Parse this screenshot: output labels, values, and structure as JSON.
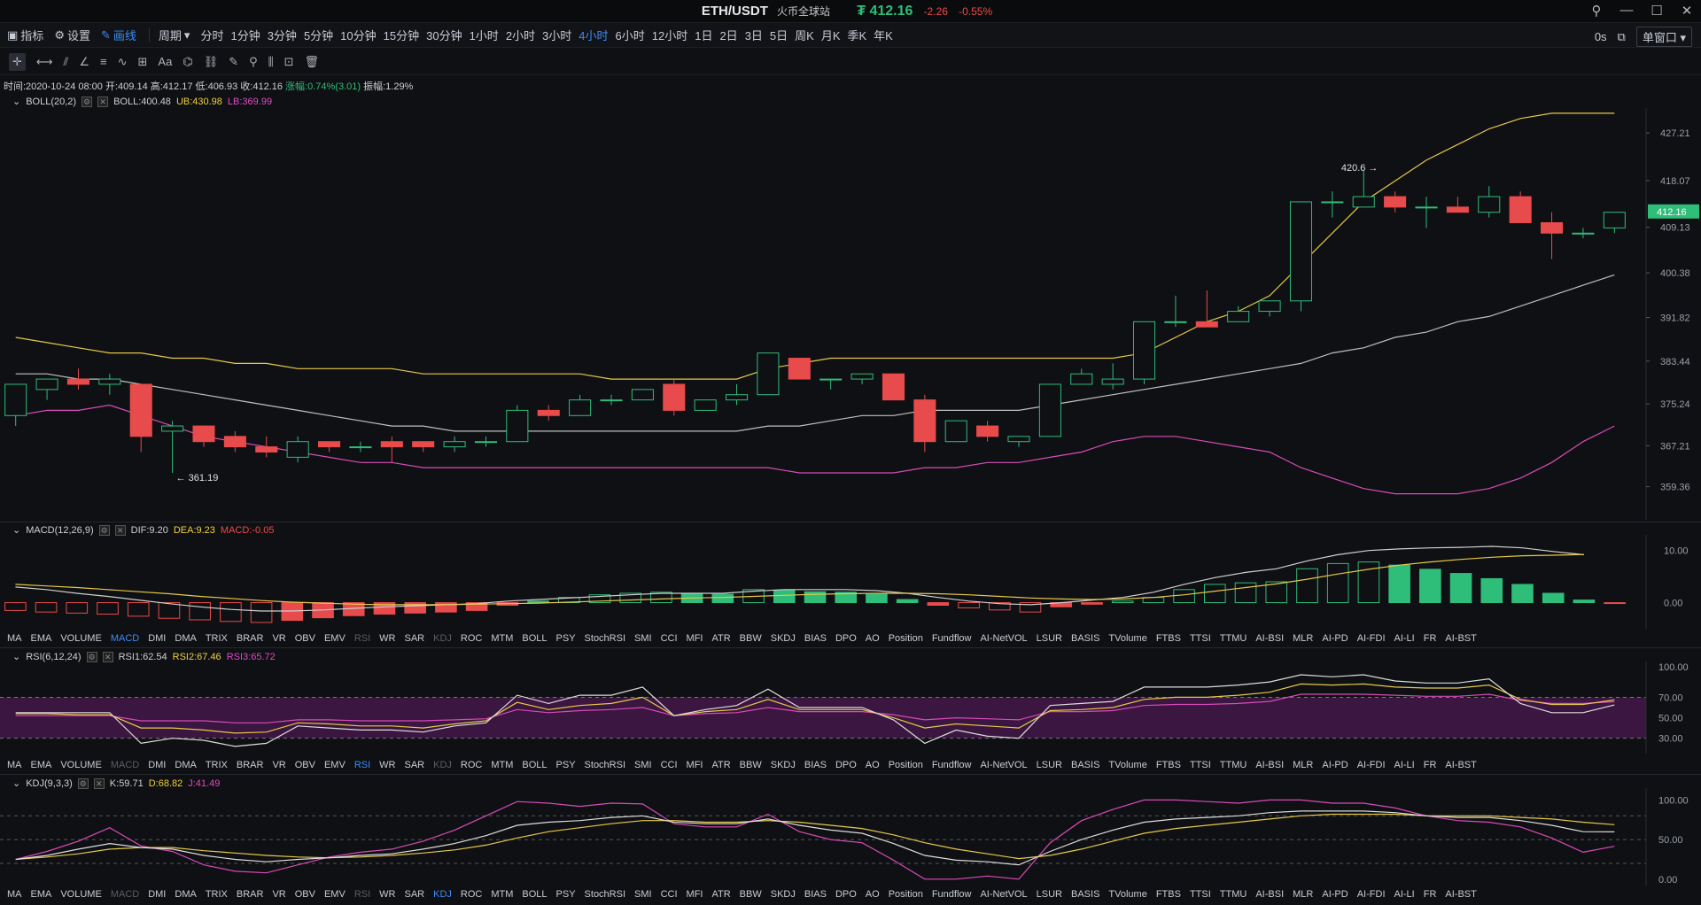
{
  "title": {
    "pair": "ETH/USDT",
    "exchange": "火币全球站",
    "price": "₮ 412.16",
    "change": "-2.26",
    "pct": "-0.55%"
  },
  "toolbar": {
    "indicators": "指标",
    "settings": "设置",
    "draw": "画线",
    "period_label": "周期",
    "periods": [
      "分时",
      "1分钟",
      "3分钟",
      "5分钟",
      "10分钟",
      "15分钟",
      "30分钟",
      "1小时",
      "2小时",
      "3小时",
      "4小时",
      "6小时",
      "12小时",
      "1日",
      "2日",
      "3日",
      "5日",
      "周K",
      "月K",
      "季K",
      "年K"
    ],
    "active_period": "4小时",
    "timer": "0s",
    "window": "单窗口"
  },
  "drawtools": [
    "✛",
    "⟷",
    "⫽",
    "∠",
    "≡",
    "∿",
    "⊞",
    "Aa",
    "⌬",
    "⛓",
    "✎",
    "⚲",
    "⫼",
    "⊡",
    "🗑"
  ],
  "info": {
    "time": "时间:2020-10-24 08:00",
    "open": "开:409.14",
    "high": "高:412.17",
    "low": "低:406.93",
    "close": "收:412.16",
    "chg": "涨幅:0.74%(3.01)",
    "amp": "振幅:1.29%"
  },
  "boll": {
    "name": "BOLL(20,2)",
    "mid": "BOLL:400.48",
    "ub": "UB:430.98",
    "lb": "LB:369.99"
  },
  "macd": {
    "name": "MACD(12,26,9)",
    "dif": "DIF:9.20",
    "dea": "DEA:9.23",
    "macd": "MACD:-0.05"
  },
  "rsi": {
    "name": "RSI(6,12,24)",
    "r1": "RSI1:62.54",
    "r2": "RSI2:67.46",
    "r3": "RSI3:65.72"
  },
  "kdj": {
    "name": "KDJ(9,3,3)",
    "k": "K:59.71",
    "d": "D:68.82",
    "j": "J:41.49"
  },
  "tabs": [
    "MA",
    "EMA",
    "VOLUME",
    "MACD",
    "DMI",
    "DMA",
    "TRIX",
    "BRAR",
    "VR",
    "OBV",
    "EMV",
    "RSI",
    "WR",
    "SAR",
    "KDJ",
    "ROC",
    "MTM",
    "BOLL",
    "PSY",
    "StochRSI",
    "SMI",
    "CCI",
    "MFI",
    "ATR",
    "BBW",
    "SKDJ",
    "BIAS",
    "DPO",
    "AO",
    "Position",
    "Fundflow",
    "AI-NetVOL",
    "LSUR",
    "BASIS",
    "TVolume",
    "FTBS",
    "TTSI",
    "TTMU",
    "AI-BSI",
    "MLR",
    "AI-PD",
    "AI-FDI",
    "AI-LI",
    "FR",
    "AI-BST"
  ],
  "chart_data": [
    {
      "type": "candlestick",
      "title": "ETH/USDT 4小时",
      "y_ticks": [
        427.21,
        418.07,
        409.13,
        400.38,
        391.82,
        383.44,
        375.24,
        367.21,
        359.36
      ],
      "current_price": "412.16",
      "annotations": [
        "420.6 →",
        "← 361.19"
      ],
      "candles": [
        [
          373,
          379,
          371,
          379
        ],
        [
          378,
          380,
          376,
          380
        ],
        [
          380,
          382,
          378,
          379
        ],
        [
          379,
          381,
          377,
          380
        ],
        [
          379,
          379,
          366,
          369
        ],
        [
          370,
          372,
          362,
          371
        ],
        [
          371,
          371,
          367,
          368
        ],
        [
          369,
          370,
          366,
          367
        ],
        [
          367,
          369,
          365,
          366
        ],
        [
          365,
          369,
          364,
          368
        ],
        [
          368,
          368,
          366,
          367
        ],
        [
          367,
          368,
          366,
          367
        ],
        [
          368,
          369,
          364,
          367
        ],
        [
          368,
          368,
          366,
          367
        ],
        [
          367,
          369,
          366,
          368
        ],
        [
          368,
          369,
          367,
          368
        ],
        [
          368,
          375,
          368,
          374
        ],
        [
          374,
          375,
          372,
          373
        ],
        [
          373,
          377,
          373,
          376
        ],
        [
          376,
          377,
          375,
          376
        ],
        [
          376,
          378,
          376,
          378
        ],
        [
          379,
          380,
          373,
          374
        ],
        [
          374,
          376,
          374,
          376
        ],
        [
          376,
          379,
          375,
          377
        ],
        [
          377,
          385,
          377,
          385
        ],
        [
          384,
          384,
          380,
          380
        ],
        [
          380,
          380,
          378,
          380
        ],
        [
          380,
          381,
          379,
          381
        ],
        [
          381,
          381,
          376,
          376
        ],
        [
          376,
          377,
          366,
          368
        ],
        [
          368,
          372,
          368,
          372
        ],
        [
          371,
          372,
          368,
          369
        ],
        [
          368,
          369,
          367,
          369
        ],
        [
          369,
          379,
          369,
          379
        ],
        [
          379,
          382,
          379,
          381
        ],
        [
          379,
          383,
          378,
          380
        ],
        [
          380,
          391,
          379,
          391
        ],
        [
          391,
          396,
          390,
          391
        ],
        [
          391,
          397,
          390,
          390
        ],
        [
          391,
          394,
          391,
          393
        ],
        [
          393,
          395,
          392,
          395
        ],
        [
          395,
          414,
          393,
          414
        ],
        [
          414,
          416,
          411,
          414
        ],
        [
          413,
          420,
          413,
          415
        ],
        [
          415,
          416,
          412,
          413
        ],
        [
          413,
          415,
          409,
          413
        ],
        [
          413,
          415,
          412,
          412
        ],
        [
          412,
          417,
          411,
          415
        ],
        [
          415,
          416,
          410,
          410
        ],
        [
          410,
          412,
          403,
          408
        ],
        [
          408,
          409,
          407,
          408
        ],
        [
          409,
          412,
          408,
          412
        ]
      ],
      "boll_mid": [
        381,
        381,
        380,
        380,
        379,
        378,
        377,
        376,
        375,
        374,
        373,
        372,
        371,
        371,
        370,
        370,
        370,
        370,
        370,
        370,
        370,
        370,
        370,
        370,
        371,
        371,
        372,
        373,
        373,
        374,
        374,
        374,
        374,
        375,
        376,
        377,
        378,
        379,
        380,
        381,
        382,
        383,
        385,
        386,
        388,
        389,
        391,
        392,
        394,
        396,
        398,
        400
      ],
      "boll_ub": [
        388,
        387,
        386,
        385,
        385,
        384,
        384,
        383,
        383,
        382,
        382,
        382,
        382,
        381,
        381,
        381,
        381,
        381,
        381,
        380,
        380,
        380,
        380,
        380,
        382,
        383,
        384,
        384,
        384,
        384,
        384,
        384,
        384,
        384,
        384,
        384,
        385,
        388,
        391,
        393,
        396,
        402,
        408,
        414,
        418,
        422,
        425,
        428,
        430,
        431,
        431,
        431
      ],
      "boll_lb": [
        373,
        374,
        374,
        375,
        373,
        371,
        369,
        368,
        367,
        366,
        365,
        364,
        364,
        363,
        363,
        363,
        363,
        363,
        363,
        363,
        363,
        363,
        363,
        363,
        363,
        362,
        362,
        362,
        362,
        363,
        363,
        364,
        364,
        365,
        366,
        368,
        369,
        369,
        368,
        367,
        366,
        363,
        361,
        359,
        358,
        358,
        358,
        359,
        361,
        364,
        368,
        371
      ]
    },
    {
      "type": "bar+line",
      "title": "MACD(12,26,9)",
      "y_ticks": [
        10.0,
        0.0
      ],
      "macd": [
        -1.5,
        -1.8,
        -2.0,
        -2.2,
        -2.6,
        -3.0,
        -3.3,
        -3.6,
        -3.8,
        -3.4,
        -2.9,
        -2.5,
        -2.2,
        -2.0,
        -1.8,
        -1.5,
        -0.5,
        0.3,
        1.0,
        1.5,
        1.8,
        2.0,
        1.8,
        1.6,
        2.5,
        2.4,
        2.1,
        2.0,
        1.6,
        0.6,
        -0.5,
        -1.0,
        -1.4,
        -1.8,
        -0.8,
        -0.3,
        0.3,
        1.0,
        2.5,
        3.5,
        3.8,
        4.0,
        6.5,
        7.5,
        7.8,
        7.2,
        6.4,
        5.6,
        4.6,
        3.5,
        1.8,
        0.5,
        -0.05
      ],
      "dif": [
        3,
        2.5,
        1.8,
        1.2,
        0.5,
        -0.2,
        -0.8,
        -1.3,
        -1.6,
        -1.6,
        -1.4,
        -1.1,
        -0.8,
        -0.6,
        -0.4,
        -0.2,
        0.3,
        0.6,
        0.9,
        1.2,
        1.5,
        1.8,
        1.8,
        1.8,
        2.2,
        2.5,
        2.5,
        2.5,
        2.3,
        1.8,
        1.0,
        0.3,
        -0.2,
        -0.4,
        0,
        0.5,
        1.0,
        2.0,
        3.5,
        4.8,
        5.8,
        6.5,
        8.0,
        9.2,
        10.0,
        10.3,
        10.5,
        10.6,
        10.8,
        10.5,
        9.8,
        9.2
      ],
      "dea": [
        3.5,
        3.2,
        2.9,
        2.5,
        2.1,
        1.7,
        1.2,
        0.8,
        0.4,
        0.1,
        -0.1,
        -0.3,
        -0.4,
        -0.4,
        -0.4,
        -0.3,
        -0.2,
        -0.1,
        0.1,
        0.3,
        0.5,
        0.7,
        0.9,
        1.0,
        1.2,
        1.4,
        1.6,
        1.7,
        1.8,
        1.8,
        1.7,
        1.5,
        1.2,
        0.9,
        0.7,
        0.6,
        0.7,
        1.0,
        1.5,
        2.2,
        2.9,
        3.6,
        4.5,
        5.5,
        6.4,
        7.2,
        7.8,
        8.3,
        8.7,
        9.0,
        9.1,
        9.23
      ]
    },
    {
      "type": "line",
      "title": "RSI(6,12,24)",
      "y_ticks": [
        100.0,
        70.0,
        50.0,
        30.0
      ],
      "rsi1": [
        55,
        55,
        55,
        55,
        25,
        30,
        28,
        22,
        25,
        42,
        40,
        38,
        38,
        36,
        42,
        45,
        72,
        64,
        72,
        72,
        80,
        52,
        58,
        62,
        78,
        60,
        60,
        60,
        48,
        25,
        38,
        32,
        30,
        62,
        64,
        66,
        80,
        80,
        80,
        82,
        85,
        92,
        90,
        92,
        86,
        84,
        84,
        88,
        64,
        55,
        55,
        62.54
      ],
      "rsi2": [
        54,
        54,
        53,
        53,
        40,
        40,
        38,
        35,
        36,
        45,
        44,
        42,
        42,
        40,
        44,
        47,
        65,
        58,
        62,
        64,
        70,
        52,
        56,
        58,
        68,
        58,
        58,
        58,
        50,
        40,
        44,
        42,
        40,
        57,
        58,
        60,
        68,
        70,
        70,
        72,
        75,
        83,
        82,
        83,
        80,
        79,
        79,
        82,
        68,
        63,
        63,
        67.46
      ],
      "rsi3": [
        52,
        52,
        52,
        52,
        47,
        47,
        47,
        45,
        45,
        48,
        48,
        47,
        47,
        47,
        48,
        49,
        58,
        55,
        57,
        58,
        60,
        52,
        54,
        55,
        60,
        56,
        56,
        56,
        53,
        48,
        50,
        49,
        48,
        56,
        56,
        57,
        62,
        63,
        63,
        64,
        66,
        73,
        73,
        73,
        72,
        71,
        71,
        73,
        67,
        64,
        64,
        65.72
      ]
    },
    {
      "type": "line",
      "title": "KDJ(9,3,3)",
      "y_ticks": [
        100.0,
        50.0,
        0.0
      ],
      "k": [
        25,
        30,
        38,
        45,
        40,
        38,
        30,
        25,
        22,
        25,
        27,
        30,
        32,
        38,
        45,
        55,
        68,
        72,
        74,
        78,
        80,
        72,
        70,
        70,
        76,
        68,
        62,
        58,
        45,
        30,
        24,
        22,
        18,
        35,
        50,
        62,
        72,
        76,
        78,
        80,
        84,
        86,
        86,
        86,
        84,
        80,
        78,
        78,
        74,
        68,
        60,
        59.71
      ],
      "d": [
        25,
        28,
        32,
        38,
        40,
        40,
        36,
        33,
        30,
        28,
        27,
        28,
        30,
        33,
        37,
        43,
        52,
        60,
        65,
        70,
        74,
        74,
        72,
        72,
        74,
        72,
        68,
        64,
        56,
        46,
        38,
        32,
        26,
        30,
        38,
        48,
        58,
        64,
        68,
        72,
        76,
        80,
        82,
        82,
        82,
        80,
        80,
        80,
        78,
        76,
        72,
        68.82
      ],
      "j": [
        25,
        35,
        48,
        65,
        42,
        35,
        18,
        10,
        8,
        18,
        28,
        34,
        38,
        48,
        62,
        80,
        98,
        96,
        92,
        96,
        95,
        70,
        66,
        66,
        82,
        60,
        50,
        46,
        24,
        0,
        0,
        4,
        0,
        46,
        74,
        88,
        100,
        100,
        98,
        96,
        100,
        100,
        96,
        96,
        90,
        80,
        74,
        72,
        66,
        52,
        34,
        41.49
      ]
    }
  ]
}
